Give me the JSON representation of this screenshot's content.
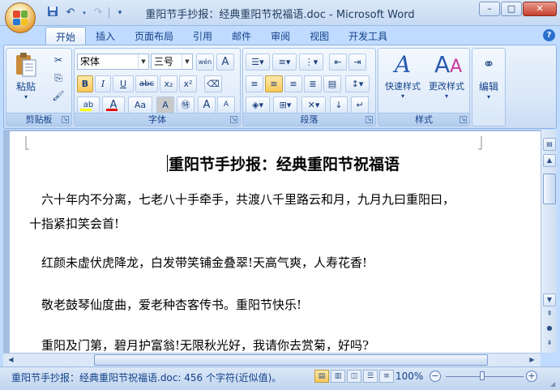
{
  "window": {
    "title": "重阳节手抄报：经典重阳节祝福语.doc - Microsoft Word",
    "controls": {
      "minimize": "–",
      "maximize": "□",
      "close": "✕"
    }
  },
  "qat": {
    "save_icon": "save-icon",
    "undo_icon": "undo-icon",
    "redo_icon": "redo-icon",
    "customize": "▾"
  },
  "tabs": [
    {
      "label": "开始",
      "active": true
    },
    {
      "label": "插入"
    },
    {
      "label": "页面布局"
    },
    {
      "label": "引用"
    },
    {
      "label": "邮件"
    },
    {
      "label": "审阅"
    },
    {
      "label": "视图"
    },
    {
      "label": "开发工具"
    }
  ],
  "help": "?",
  "ribbon": {
    "clipboard": {
      "label": "剪贴板",
      "paste": "粘贴"
    },
    "font": {
      "label": "字体",
      "font_name": "宋体",
      "font_size": "三号",
      "wen_icon": "wén",
      "bold": "B",
      "italic": "I",
      "underline": "U",
      "strike": "abc",
      "sub": "x₂",
      "sup": "x²",
      "font_color": "A",
      "case": "Aa",
      "grow": "A",
      "shrink": "A"
    },
    "paragraph": {
      "label": "段落"
    },
    "styles": {
      "label": "样式",
      "quick_styles": "快速样式",
      "change_styles": "更改样式"
    },
    "editing": {
      "label": "编辑"
    }
  },
  "document": {
    "title": "重阳节手抄报：经典重阳节祝福语",
    "paragraphs": [
      "六十年内不分离，七老八十手牵手，共渡八千里路云和月，九月九曰重阳曰，",
      "十指紧扣笑会首!",
      "红颜未虚伏虎降龙，白发带笑铺金叠翠!天高气爽，人寿花香!",
      "敬老鼓琴仙度曲，爱老种杏客传书。重阳节快乐!",
      "重阳及门第，碧月护富翁!无限秋光好，我请你去赏菊，好吗?"
    ]
  },
  "statusbar": {
    "text": "重阳节手抄报：经典重阳节祝福语.doc: 456 个字符(近似值)。",
    "zoom": "100%",
    "zoom_level": 1.0
  },
  "colors": {
    "accent": "#15428b",
    "ribbon_bg": "#dbe8f8",
    "highlight": "#f8c85c",
    "font_color_bar": "#e01010",
    "highlight_bar": "#ffff00"
  }
}
